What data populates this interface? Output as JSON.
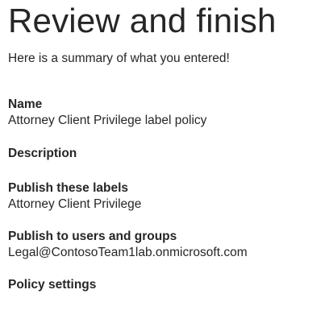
{
  "page": {
    "title": "Review and finish",
    "subtitle": "Here is a summary of what you entered!"
  },
  "summary": {
    "name": {
      "label": "Name",
      "value": "Attorney Client Privilege label policy"
    },
    "description": {
      "label": "Description",
      "value": ""
    },
    "publish_labels": {
      "label": "Publish these labels",
      "value": "Attorney Client Privilege"
    },
    "publish_users": {
      "label": "Publish to users and groups",
      "value": "Legal@ContosoTeam1lab.onmicrosoft.com"
    },
    "policy_settings": {
      "label": "Policy settings"
    }
  }
}
